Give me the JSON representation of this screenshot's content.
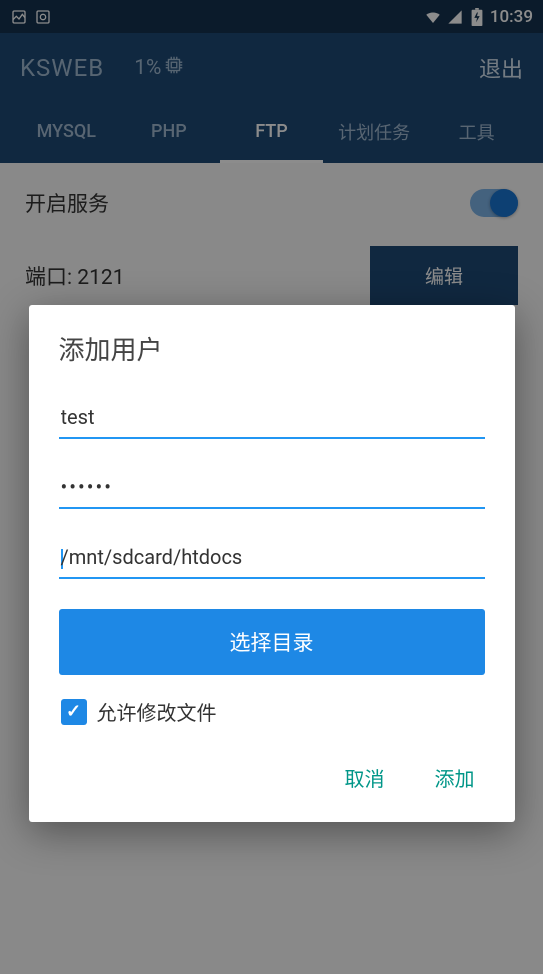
{
  "status_bar": {
    "time": "10:39"
  },
  "app_bar": {
    "title": "KSWEB",
    "cpu": "1%",
    "exit": "退出"
  },
  "tabs": {
    "mysql": "MYSQL",
    "php": "PHP",
    "ftp": "FTP",
    "tasks": "计划任务",
    "tools": "工具"
  },
  "ftp": {
    "enable_service": "开启服务",
    "port_label": "端口: 2121",
    "edit": "编辑"
  },
  "dialog": {
    "title": "添加用户",
    "username": "test",
    "password": "••••••",
    "path": "/mnt/sdcard/htdocs",
    "select_dir": "选择目录",
    "allow_modify": "允许修改文件",
    "cancel": "取消",
    "add": "添加"
  }
}
